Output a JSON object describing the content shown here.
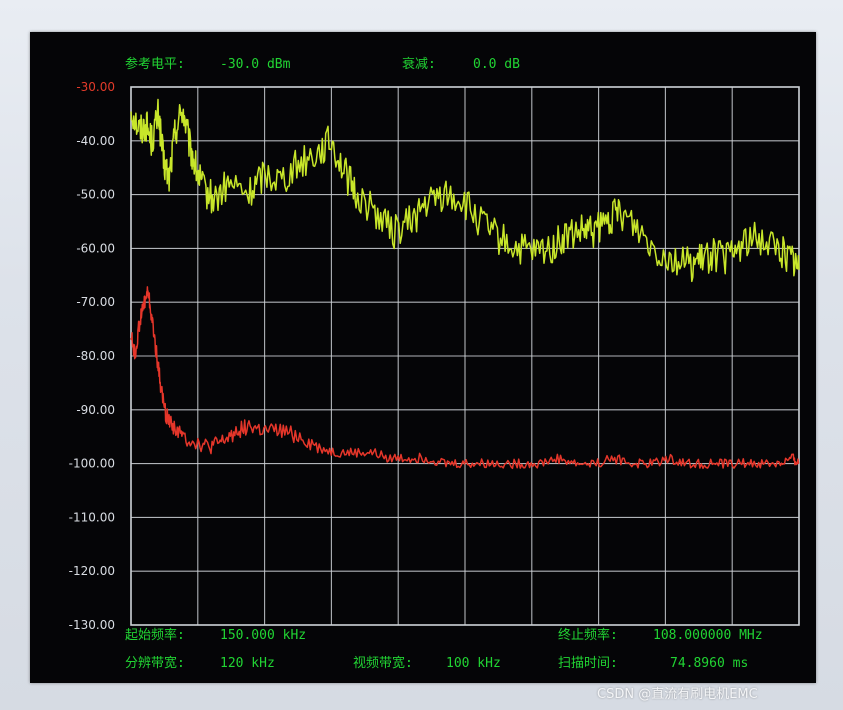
{
  "header": {
    "ref_level_label": "参考电平:",
    "ref_level_value": "-30.0 dBm",
    "atten_label": "衰减:",
    "atten_value": "0.0 dB"
  },
  "footer": {
    "start_freq_label": "起始频率:",
    "start_freq_value": "150.000 kHz",
    "stop_freq_label": "终止频率:",
    "stop_freq_value": "108.000000 MHz",
    "rbw_label": "分辨带宽:",
    "rbw_value": "120 kHz",
    "vbw_label": "视频带宽:",
    "vbw_value": "100 kHz",
    "sweep_label": "扫描时间:",
    "sweep_value": "74.8960 ms"
  },
  "watermark": "CSDN @直流有刷电机EMC",
  "colors": {
    "background": "#050507",
    "grid": "#cfd3d8",
    "label_text": "#21d433",
    "tick_text": "#d9dde3",
    "ref_tick_text": "#e33b2a",
    "upper_trace": "#c8e62a",
    "lower_trace": "#e5362a"
  },
  "chart_data": {
    "type": "line",
    "title": "",
    "xlabel": "",
    "ylabel": "",
    "x_unit": "MHz",
    "xlim": [
      0.15,
      108.0
    ],
    "ylim": [
      -130,
      -30
    ],
    "x_divisions": 10,
    "y_ticks": [
      "-30.00",
      "-40.00",
      "-50.00",
      "-60.00",
      "-70.00",
      "-80.00",
      "-90.00",
      "-100.00",
      "-110.00",
      "-120.00",
      "-130.00"
    ],
    "grid": true,
    "legend": "none",
    "series": [
      {
        "color": "#c8e62a",
        "x": [
          0.15,
          1.5,
          2.6,
          3.5,
          4.6,
          5.4,
          6.3,
          7.3,
          8.5,
          9.6,
          10.6,
          11.8,
          13.6,
          16.0,
          19.2,
          21.6,
          24.5,
          27.4,
          30.3,
          32.5,
          34.7,
          36.5,
          39.5,
          42.4,
          45.3,
          47.6,
          50.5,
          53.5,
          56.4,
          59.3,
          62.3,
          65.2,
          68.0,
          70.2,
          72.9,
          74.8,
          77.2,
          79.0,
          81.9,
          84.9,
          87.8,
          90.7,
          92.6,
          94.0,
          96.5,
          98.9,
          101.8,
          104.7,
          106.9,
          108.0
        ],
        "values": [
          -34,
          -38,
          -37,
          -40,
          -35,
          -44,
          -47,
          -38,
          -34,
          -41,
          -45,
          -49,
          -51,
          -48,
          -50,
          -46,
          -47,
          -44,
          -42,
          -40,
          -46,
          -50,
          -53,
          -57,
          -55,
          -52,
          -50,
          -51,
          -55,
          -58,
          -60,
          -61,
          -60,
          -58,
          -57,
          -57,
          -55,
          -53,
          -56,
          -60,
          -62,
          -63,
          -62,
          -61,
          -62,
          -59,
          -58,
          -60,
          -62,
          -64
        ]
      },
      {
        "color": "#e5362a",
        "x": [
          0.15,
          0.8,
          1.5,
          2.3,
          2.9,
          3.5,
          4.2,
          5.0,
          5.8,
          7.0,
          8.5,
          10.6,
          12.7,
          14.9,
          17.1,
          19.2,
          21.6,
          24.5,
          27.4,
          30.3,
          33.2,
          36.1,
          39.1,
          42.0,
          45.0,
          48.0,
          51.0,
          54.0,
          57.0,
          60.0,
          63.0,
          66.0,
          69.0,
          72.0,
          75.0,
          78.0,
          81.0,
          84.0,
          87.0,
          90.0,
          93.0,
          96.0,
          99.0,
          102.0,
          105.0,
          107.0,
          108.0
        ],
        "values": [
          -76,
          -80,
          -74,
          -70,
          -68,
          -73,
          -79,
          -86,
          -91,
          -93,
          -95,
          -96,
          -97,
          -96,
          -94,
          -93,
          -94,
          -94,
          -95,
          -97,
          -98,
          -98,
          -98,
          -99,
          -99,
          -99,
          -100,
          -100,
          -100,
          -100,
          -100,
          -100,
          -99,
          -100,
          -100,
          -99,
          -100,
          -100,
          -99,
          -100,
          -100,
          -100,
          -100,
          -100,
          -100,
          -99,
          -100
        ]
      }
    ]
  }
}
